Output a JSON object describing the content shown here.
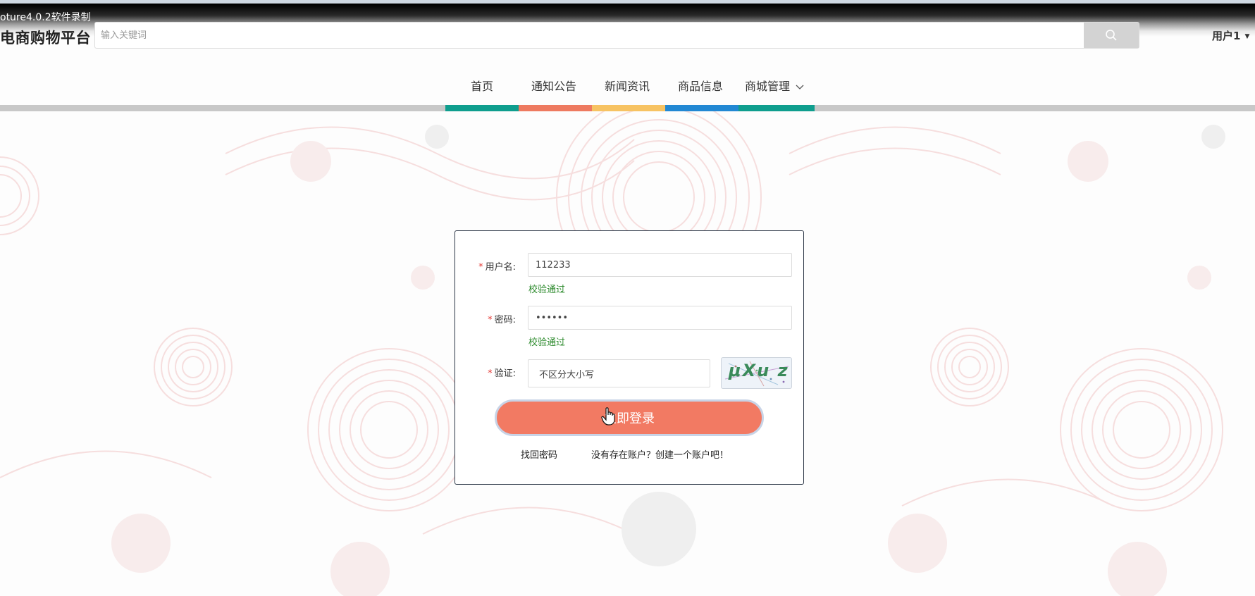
{
  "recorder": {
    "label": "oture4.0.2软件录制"
  },
  "header": {
    "brand": "电商购物平台",
    "search_placeholder": "输入关键词",
    "search_icon": "search-icon",
    "user_label": "用户1"
  },
  "nav": {
    "items": [
      {
        "label": "首页",
        "color": "#0f9e8e"
      },
      {
        "label": "通知公告",
        "color": "#ee7a60"
      },
      {
        "label": "新闻资讯",
        "color": "#f7c363"
      },
      {
        "label": "商品信息",
        "color": "#2288d3"
      },
      {
        "label": "商城管理",
        "color": "#0f9e8e",
        "icon": "chevron-down-icon"
      }
    ],
    "track_color": "#c8c8c8"
  },
  "login": {
    "username_label": "用户名:",
    "username_value": "112233",
    "username_hint": "校验通过",
    "password_label": "密码:",
    "password_value": "••••••",
    "password_hint": "校验通过",
    "captcha_label": "验证:",
    "captcha_value": "不区分大小写",
    "captcha_text": "μXu z",
    "submit_label": "立即登录",
    "forgot_link": "找回密码",
    "register_link": "没有存在账户？创建一个账户吧！",
    "accent_color": "#f27a63",
    "hint_color": "#2e8b2e",
    "required_color": "#e53935"
  }
}
